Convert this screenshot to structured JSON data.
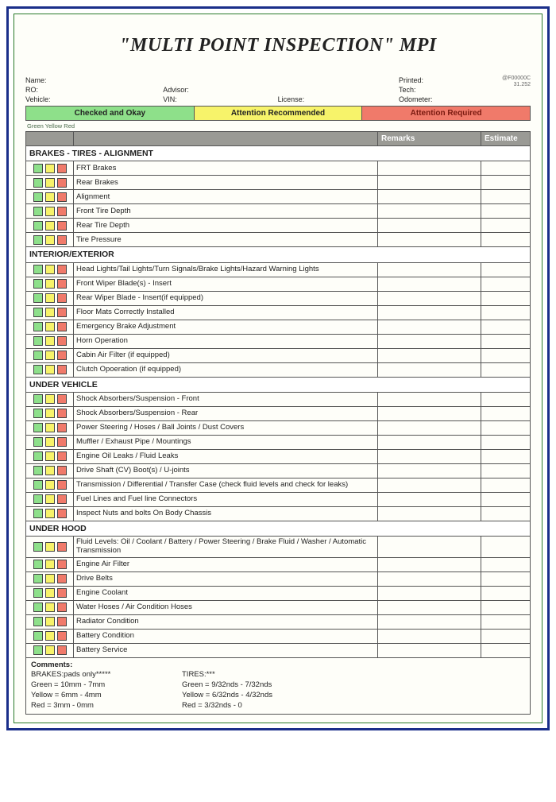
{
  "title": "\"MULTI POINT INSPECTION\" MPI",
  "header": {
    "name_label": "Name:",
    "ro_label": "RO:",
    "vehicle_label": "Vehicle:",
    "advisor_label": "Advisor:",
    "vin_label": "VIN:",
    "license_label": "License:",
    "printed_label": "Printed:",
    "tech_label": "Tech:",
    "odometer_label": "Odometer:",
    "code_top": "@F00000C",
    "code_bot": "31.252"
  },
  "legend": {
    "green": "Checked and Okay",
    "yellow": "Attention Recommended",
    "red": "Attention Required",
    "sub": "Green Yellow Red"
  },
  "columns": {
    "blank": " ",
    "desc": " ",
    "remarks": "Remarks",
    "estimate": "Estimate"
  },
  "sections": [
    {
      "heading": "BRAKES - TIRES - ALIGNMENT",
      "items": [
        "FRT Brakes",
        "Rear Brakes",
        "Alignment",
        "Front Tire Depth",
        "Rear Tire Depth",
        "Tire Pressure"
      ]
    },
    {
      "heading": "INTERIOR/EXTERIOR",
      "items": [
        "Head Lights/Tail Lights/Turn Signals/Brake Lights/Hazard Warning Lights",
        "Front Wiper Blade(s) - Insert",
        "Rear Wiper Blade - Insert(if equipped)",
        "Floor Mats Correctly Installed",
        "Emergency Brake Adjustment",
        "Horn Operation",
        "Cabin Air Filter (if equipped)",
        "Clutch Opoeration (if equipped)"
      ]
    },
    {
      "heading": "UNDER VEHICLE",
      "items": [
        "Shock Absorbers/Suspension - Front",
        "Shock Absorbers/Suspension - Rear",
        "Power Steering / Hoses / Ball Joints / Dust Covers",
        "Muffler / Exhaust Pipe / Mountings",
        "Engine Oil Leaks / Fluid Leaks",
        "Drive Shaft (CV) Boot(s) / U-joints",
        "Transmission / Differential / Transfer Case (check fluid levels and check for leaks)",
        "Fuel Lines and Fuel line Connectors",
        "Inspect Nuts and bolts On Body Chassis"
      ]
    },
    {
      "heading": "UNDER HOOD",
      "items": [
        "Fluid Levels: Oil / Coolant / Battery / Power Steering / Brake Fluid / Washer / Automatic Transmission",
        "Engine Air Filter",
        "Drive Belts",
        "Engine Coolant",
        "Water Hoses / Air Condition Hoses",
        "Radiator Condition",
        "Battery Condition",
        "Battery Service"
      ]
    }
  ],
  "comments": {
    "heading": "Comments:",
    "brakes_title": "BRAKES:pads only*****",
    "tires_title": "TIRES:***",
    "brakes_green": "Green  = 10mm - 7mm",
    "brakes_yellow": "Yellow =  6mm - 4mm",
    "brakes_red": "Red    =  3mm - 0mm",
    "tires_green": "Green  = 9/32nds - 7/32nds",
    "tires_yellow": "Yellow = 6/32nds - 4/32nds",
    "tires_red": "Red    = 3/32nds - 0"
  }
}
